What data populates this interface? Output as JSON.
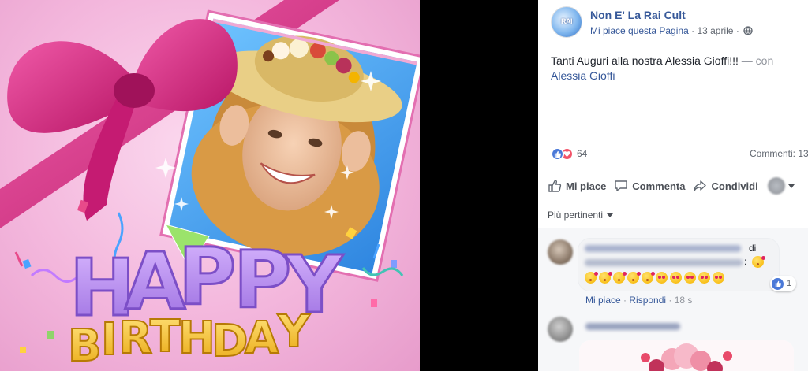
{
  "photo": {
    "letters_happy": [
      "H",
      "A",
      "P",
      "P",
      "Y"
    ],
    "letters_birthday": [
      "B",
      "I",
      "R",
      "T",
      "H",
      "D",
      "A",
      "Y"
    ]
  },
  "post": {
    "avatar_logo": "RAI",
    "page_name": "Non E' La Rai Cult",
    "like_page": "Mi piace questa Pagina",
    "separator": "·",
    "date": "13 aprile",
    "separator2": "·",
    "text": "Tanti Auguri alla nostra Alessia Gioffi!!!",
    "with": "— con",
    "tagged": "Alessia Gioffi",
    "reaction_count": "64",
    "comments_count": "Commenti: 13",
    "actions": {
      "like": "Mi piace",
      "comment": "Commenta",
      "share": "Condividi"
    },
    "sort_label": "Più pertinenti"
  },
  "comments": [
    {
      "suffix1": "di",
      "suffix2": ":",
      "like_count": "1",
      "actions": {
        "like": "Mi piace",
        "sep": " · ",
        "reply": "Rispondi",
        "sep2": " · ",
        "time": "18 s"
      }
    }
  ],
  "colors": {
    "link": "#365899",
    "meta": "#616770",
    "like_blue": "#4a79d8",
    "love_red": "#f25268",
    "ribbon": "#d9247f",
    "happy_purple": "#b98ff2",
    "birthday_yellow": "#f7c531"
  },
  "icons": [
    "globe-icon",
    "like-reaction-icon",
    "love-reaction-icon",
    "thumbs-up-icon",
    "comment-icon",
    "share-icon",
    "caret-down-icon"
  ]
}
